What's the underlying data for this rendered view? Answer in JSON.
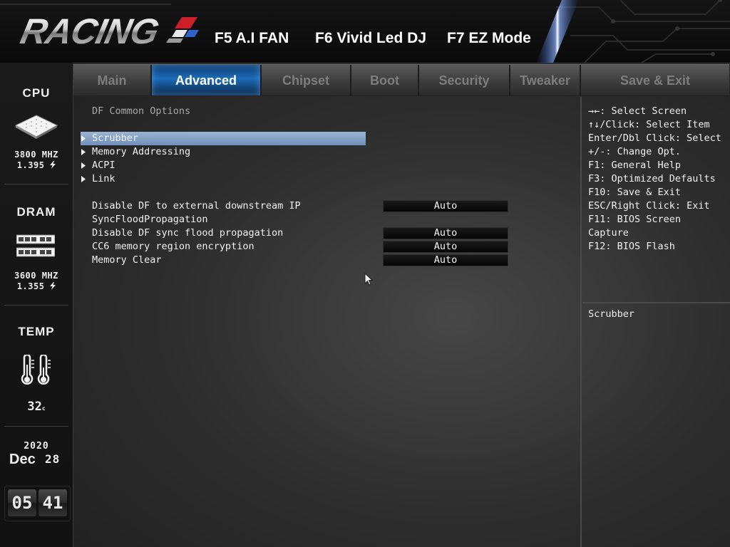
{
  "header": {
    "logo_text": "RACING",
    "hotkeys": [
      "F5 A.I FAN",
      "F6 Vivid Led DJ",
      "F7 EZ Mode"
    ]
  },
  "sidebar": {
    "cpu": {
      "title": "CPU",
      "freq": "3800 MHZ",
      "voltage": "1.395"
    },
    "dram": {
      "title": "DRAM",
      "freq": "3600 MHZ",
      "voltage": "1.355"
    },
    "temp": {
      "title": "TEMP",
      "value": "32",
      "unit": "c"
    },
    "date": {
      "year": "2020",
      "month": "Dec",
      "day": "28"
    },
    "clock": {
      "hour": "05",
      "minute": "41"
    }
  },
  "tabs": [
    {
      "label": "Main"
    },
    {
      "label": "Advanced"
    },
    {
      "label": "Chipset"
    },
    {
      "label": "Boot"
    },
    {
      "label": "Security"
    },
    {
      "label": "Tweaker"
    },
    {
      "label": "Save & Exit"
    }
  ],
  "active_tab": "Advanced",
  "main": {
    "section_title": "DF Common Options",
    "submenus": [
      {
        "label": "Scrubber"
      },
      {
        "label": "Memory Addressing"
      },
      {
        "label": "ACPI"
      },
      {
        "label": "Link"
      }
    ],
    "selected_item": "Scrubber",
    "settings": [
      {
        "label": "Disable DF to external downstream IP",
        "value": "Auto"
      },
      {
        "label": "SyncFloodPropagation",
        "value": ""
      },
      {
        "label": "Disable DF sync flood propagation",
        "value": "Auto"
      },
      {
        "label": "CC6 memory region encryption",
        "value": "Auto"
      },
      {
        "label": "Memory Clear",
        "value": "Auto"
      }
    ]
  },
  "help": {
    "keys": [
      "→←: Select Screen",
      "↑↓/Click: Select Item",
      "Enter/Dbl Click: Select",
      "+/-: Change Opt.",
      "F1: General Help",
      "F3: Optimized Defaults",
      "F10: Save & Exit",
      "ESC/Right Click: Exit",
      "F11: BIOS Screen",
      "Capture",
      "F12: BIOS Flash"
    ],
    "description": "Scrubber"
  },
  "colors": {
    "active_tab": "#1c6bb8",
    "selection": "#8aa5c8",
    "value_box": "#050505",
    "text": "#f2f2f2"
  },
  "icons": [
    "cpu-chip-icon",
    "dram-module-icon",
    "thermometer-icon",
    "voltage-bolt-icon",
    "submenu-arrow-icon",
    "mouse-cursor-icon"
  ]
}
